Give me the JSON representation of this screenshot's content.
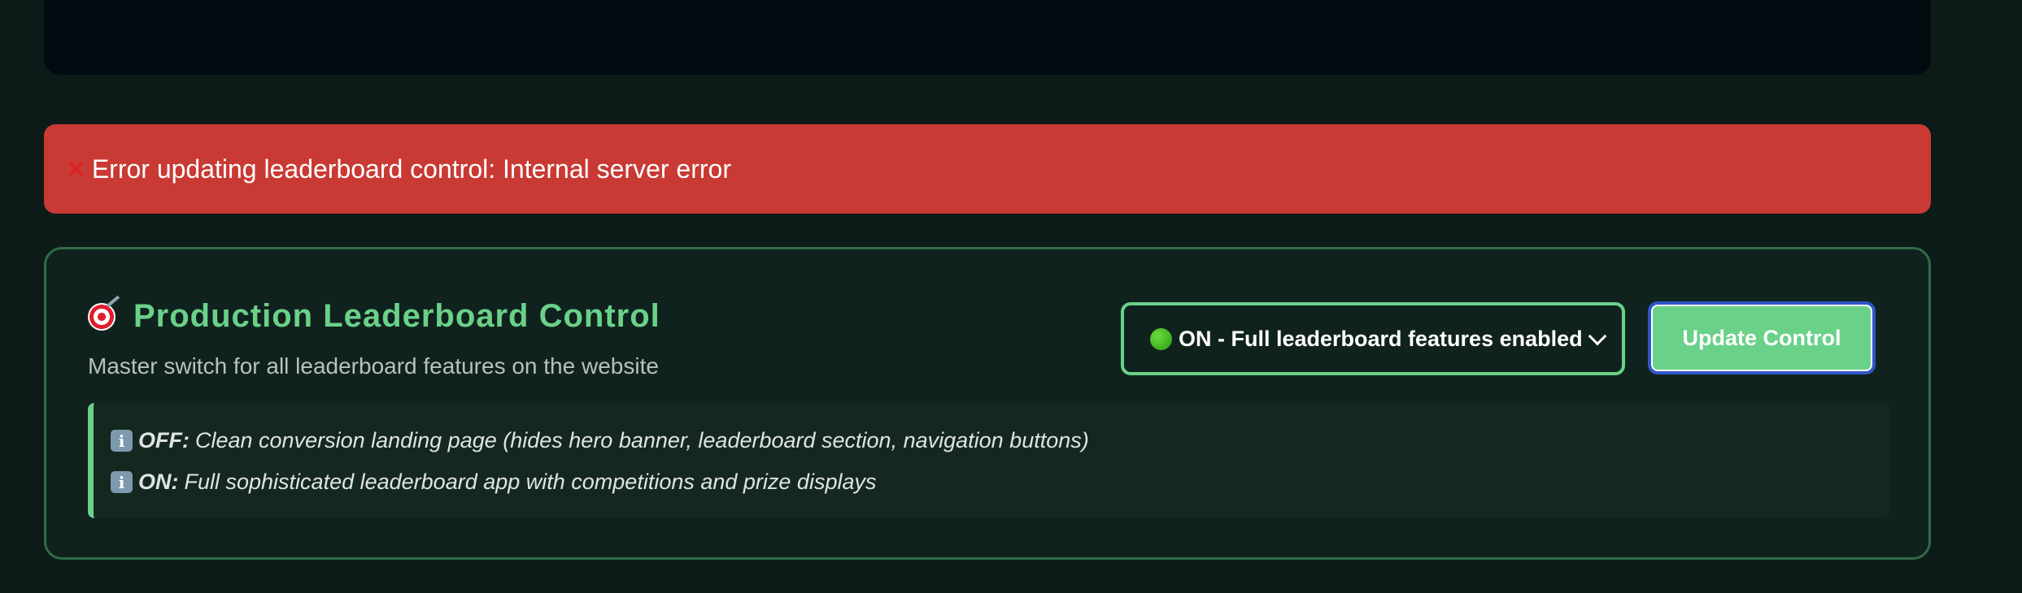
{
  "error": {
    "icon": "cross-mark-icon",
    "icon_glyph": "✕",
    "message": "Error updating leaderboard control: Internal server error"
  },
  "control": {
    "icon": "target-icon",
    "title": "Production Leaderboard Control",
    "subtitle": "Master switch for all leaderboard features on the website",
    "select": {
      "status_icon": "green-circle-icon",
      "selected": "ON - Full leaderboard features enabled"
    },
    "button_label": "Update Control",
    "info": [
      {
        "icon": "info-icon",
        "icon_glyph": "i",
        "key": "OFF:",
        "text": "Clean conversion landing page (hides hero banner, leaderboard section, navigation buttons)"
      },
      {
        "icon": "info-icon",
        "icon_glyph": "i",
        "key": "ON:",
        "text": "Full sophisticated leaderboard app with competitions and prize displays"
      }
    ]
  },
  "colors": {
    "background": "#0d1b18",
    "error": "#c93a34",
    "accent_green": "#6ad189",
    "card_border": "#2f6b48",
    "button_border": "#2f56c8"
  }
}
